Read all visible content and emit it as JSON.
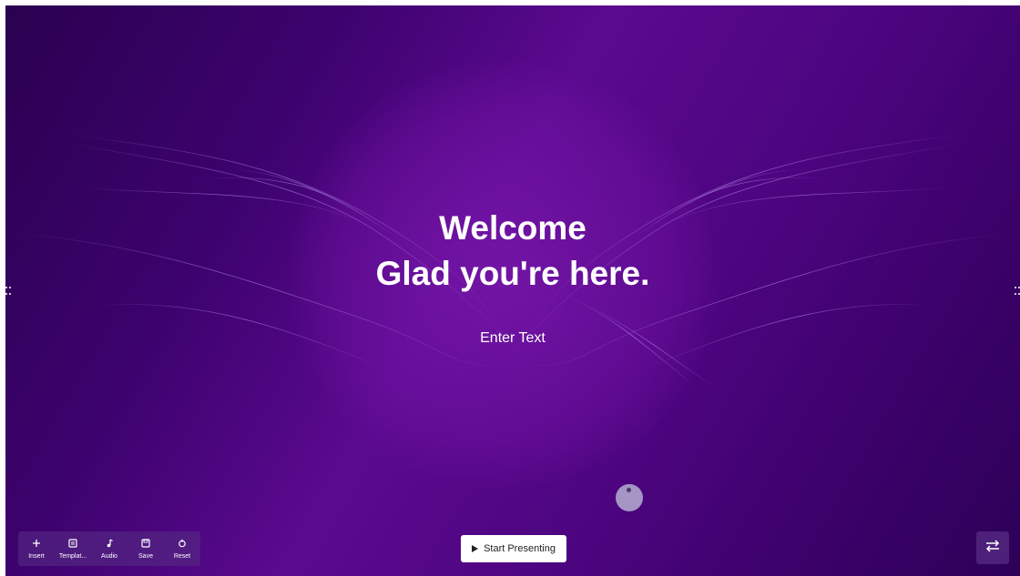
{
  "slide": {
    "title_line1": "Welcome",
    "title_line2": "Glad you're here.",
    "subtitle": "Enter Text"
  },
  "toolbar": {
    "items": [
      {
        "label": "Insert",
        "icon": "plus-icon"
      },
      {
        "label": "Templat...",
        "icon": "template-icon"
      },
      {
        "label": "Audio",
        "icon": "music-note-icon"
      },
      {
        "label": "Save",
        "icon": "save-icon"
      },
      {
        "label": "Reset",
        "icon": "reset-icon"
      }
    ]
  },
  "present_button": {
    "label": "Start Presenting",
    "icon": "play-icon"
  },
  "switch_button": {
    "icon": "swap-arrows-icon"
  },
  "colors": {
    "background_dark": "#2a0150",
    "background_mid": "#5a0a8f",
    "text": "#ffffff",
    "orb": "#a495c4"
  }
}
